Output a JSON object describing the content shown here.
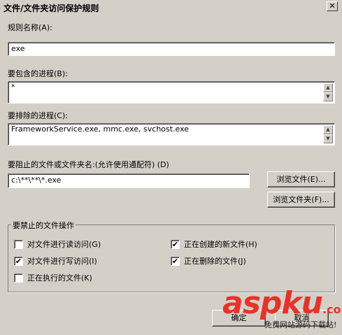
{
  "window": {
    "title": "文件/文件夹访问保护规则",
    "close_glyph": "✕"
  },
  "rule_name": {
    "label": "规则名称(A):",
    "value": "exe"
  },
  "include_processes": {
    "label": "要包含的进程(B):",
    "value": "*"
  },
  "exclude_processes": {
    "label": "要排除的进程(C):",
    "value": "FrameworkService.exe, mmc.exe, svchost.exe"
  },
  "block_path": {
    "label": "要阻止的文件或文件夹名:(允许使用通配符) (D)",
    "value": "c:\\**\\**\\*.exe"
  },
  "buttons": {
    "browse_file": "浏览文件(E)...",
    "browse_folder": "浏览文件夹(F)...",
    "ok": "确定",
    "cancel": "取消"
  },
  "operations": {
    "title": "要禁止的文件操作",
    "read": {
      "label": "对文件进行读访问(G)",
      "checked": false
    },
    "write": {
      "label": "对文件进行写访问(I)",
      "checked": true
    },
    "execute": {
      "label": "正在执行的文件(K)",
      "checked": false
    },
    "create": {
      "label": "正在创建的新文件(H)",
      "checked": true
    },
    "delete": {
      "label": "正在删除的文件(J)",
      "checked": true
    }
  },
  "watermark": {
    "brand": "aspku",
    "dotcom": ".com",
    "tagline": "免费网站源码下载站!"
  },
  "icons": {
    "check": "✔",
    "scroll_up": "▲",
    "scroll_down": "▼"
  }
}
